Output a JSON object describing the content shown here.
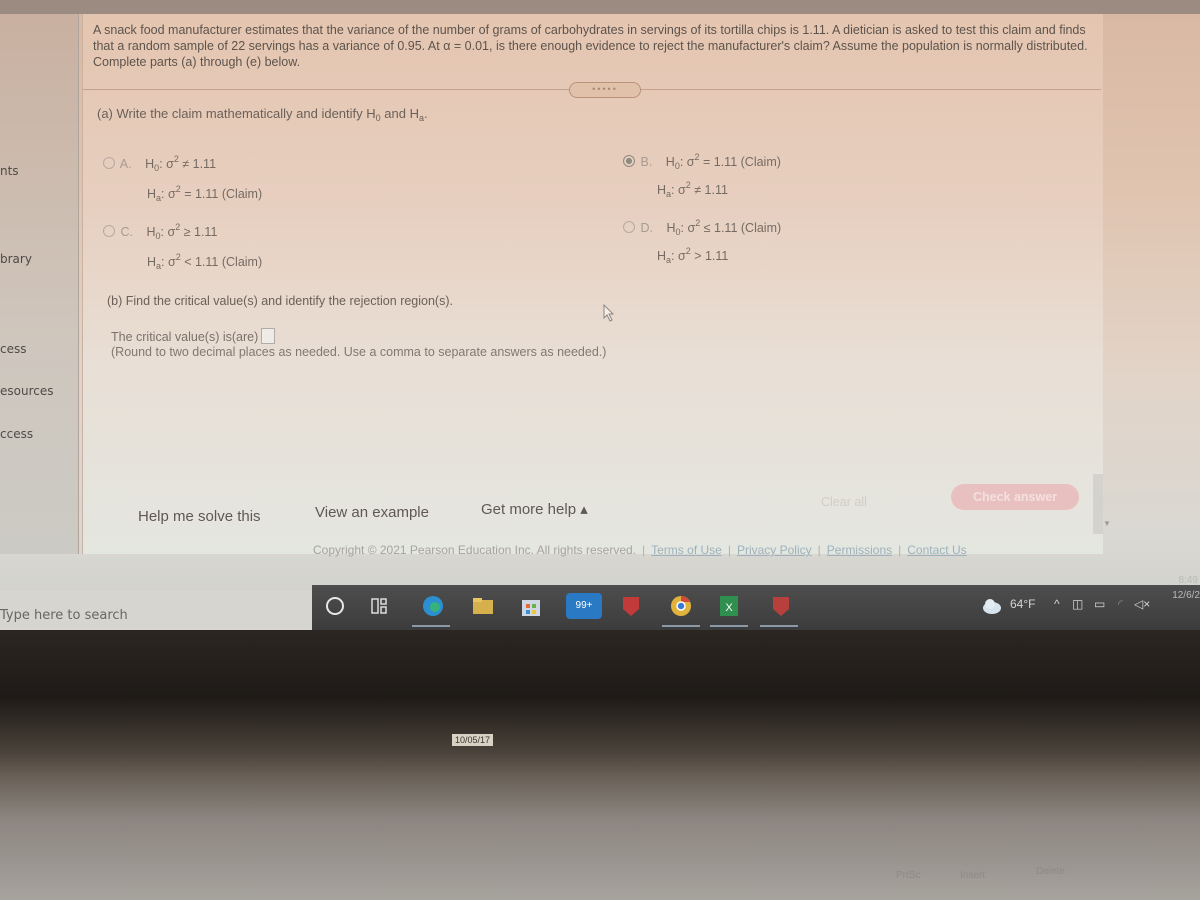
{
  "sidebar": {
    "items": [
      {
        "label": "nts"
      },
      {
        "label": "brary"
      },
      {
        "label": "cess"
      },
      {
        "label": "esources"
      },
      {
        "label": "ccess"
      }
    ]
  },
  "problem": {
    "text": "A snack food manufacturer estimates that the variance of the number of grams of carbohydrates in servings of its tortilla chips is 1.11. A dietician is asked to test this claim and finds that a random sample of 22 servings has a variance of 0.95. At α = 0.01, is there enough evidence to reject the manufacturer's claim? Assume the population is normally distributed. Complete parts (a) through (e) below.",
    "more_label": "•••••"
  },
  "part_a": {
    "prompt_prefix": "(a) Write the claim mathematically and identify H",
    "prompt_sub0": "0",
    "prompt_mid": " and H",
    "prompt_suba": "a",
    "prompt_end": ".",
    "options": [
      {
        "letter": "A.",
        "checked": false,
        "h0": ": σ",
        "h0_rel": " ≠ 1.11",
        "ha": ": σ",
        "ha_rel": " = 1.11 (Claim)"
      },
      {
        "letter": "B.",
        "checked": true,
        "h0": ": σ",
        "h0_rel": " = 1.11 (Claim)",
        "ha": ": σ",
        "ha_rel": " ≠ 1.11"
      },
      {
        "letter": "C.",
        "checked": false,
        "h0": ": σ",
        "h0_rel": " ≥ 1.11",
        "ha": ": σ",
        "ha_rel": " < 1.11 (Claim)"
      },
      {
        "letter": "D.",
        "checked": false,
        "h0": ": σ",
        "h0_rel": " ≤ 1.11 (Claim)",
        "ha": ": σ",
        "ha_rel": " > 1.11"
      }
    ],
    "h": "H",
    "sub0": "0",
    "suba": "a",
    "sq": "2"
  },
  "part_b": {
    "prompt": "(b) Find the critical value(s) and identify the rejection region(s).",
    "critical_label": "The critical value(s) is(are)",
    "critical_value": "",
    "note": "(Round to two decimal places as needed. Use a comma to separate answers as needed.)"
  },
  "actions": {
    "help_me_solve": "Help me solve this",
    "view_example": "View an example",
    "get_more_help": "Get more help ▴",
    "clear_all": "Clear all",
    "check_answer": "Check answer"
  },
  "footer": {
    "copyright": "Copyright © 2021 Pearson Education Inc. All rights reserved.",
    "links": [
      "Terms of Use",
      "Privacy Policy",
      "Permissions",
      "Contact Us"
    ]
  },
  "taskbar": {
    "search_placeholder": "Type here to search",
    "mail_badge": "99+",
    "weather": "64°F",
    "time": "8:49",
    "date": "12/6/2"
  },
  "bezel": {
    "sticker": "10/05/17",
    "keys": [
      "PrtSc",
      "Insert",
      "Delete"
    ]
  }
}
